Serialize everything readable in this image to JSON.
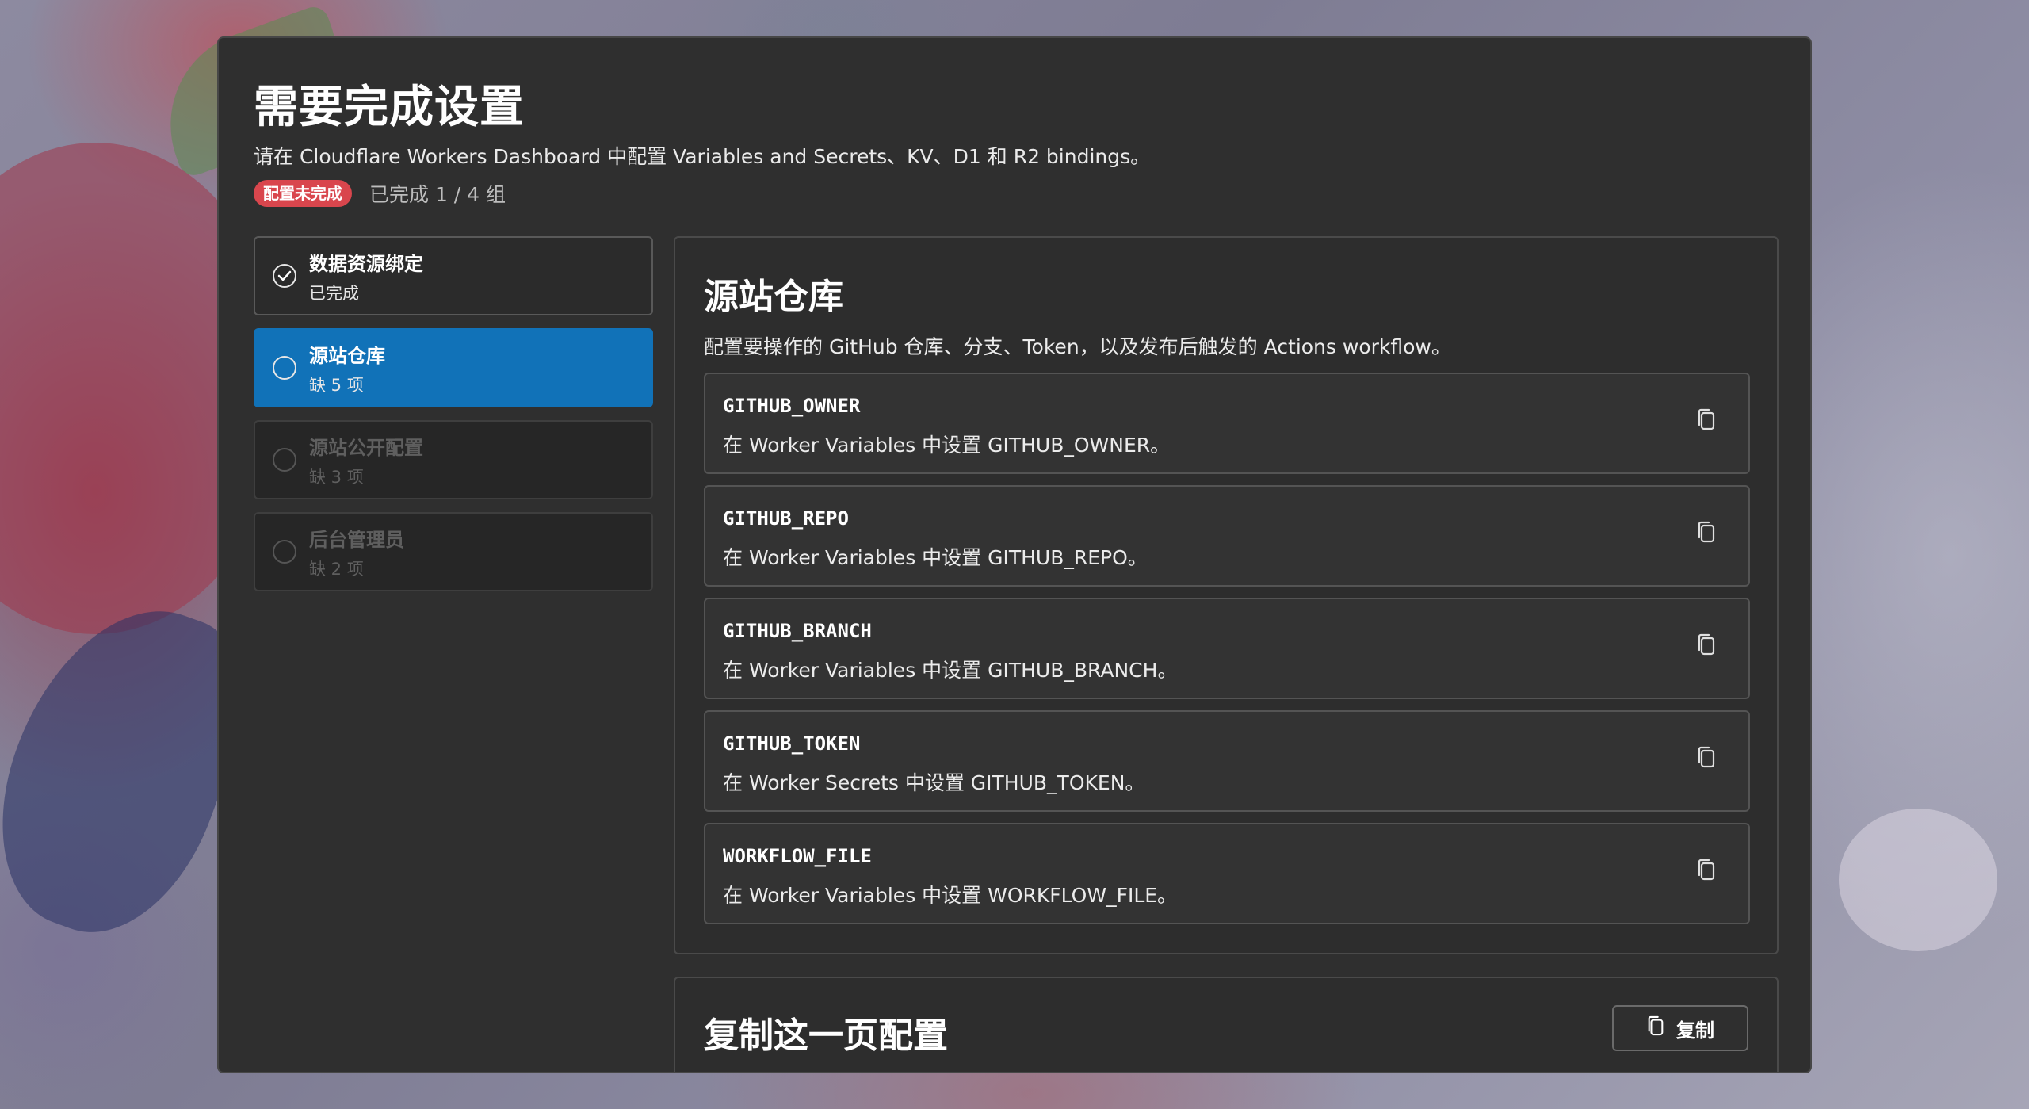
{
  "page": {
    "title": "需要完成设置",
    "subtitle": "请在 Cloudflare Workers Dashboard 中配置 Variables and Secrets、KV、D1 和 R2 bindings。",
    "badge": "配置未完成",
    "progress": "已完成 1 / 4 组"
  },
  "sidebar": {
    "items": [
      {
        "title": "数据资源绑定",
        "sub": "已完成",
        "state": "done"
      },
      {
        "title": "源站仓库",
        "sub": "缺 5 项",
        "state": "active"
      },
      {
        "title": "源站公开配置",
        "sub": "缺 3 项",
        "state": "disabled"
      },
      {
        "title": "后台管理员",
        "sub": "缺 2 项",
        "state": "disabled"
      }
    ]
  },
  "main": {
    "title": "源站仓库",
    "description": "配置要操作的 GitHub 仓库、分支、Token，以及发布后触发的 Actions workflow。",
    "vars": [
      {
        "name": "GITHUB_OWNER",
        "desc": "在 Worker Variables 中设置 GITHUB_OWNER。"
      },
      {
        "name": "GITHUB_REPO",
        "desc": "在 Worker Variables 中设置 GITHUB_REPO。"
      },
      {
        "name": "GITHUB_BRANCH",
        "desc": "在 Worker Variables 中设置 GITHUB_BRANCH。"
      },
      {
        "name": "GITHUB_TOKEN",
        "desc": "在 Worker Secrets 中设置 GITHUB_TOKEN。"
      },
      {
        "name": "WORKFLOW_FILE",
        "desc": "在 Worker Variables 中设置 WORKFLOW_FILE。"
      }
    ]
  },
  "copy_section": {
    "title": "复制这一页配置",
    "button_label": "复制"
  },
  "icons": {
    "done": "check-circle-icon",
    "pending": "circle-icon",
    "copy": "copy-icon"
  },
  "colors": {
    "accent": "#1172b8",
    "badge": "#d9464d",
    "panel": "#2f2f2f"
  }
}
